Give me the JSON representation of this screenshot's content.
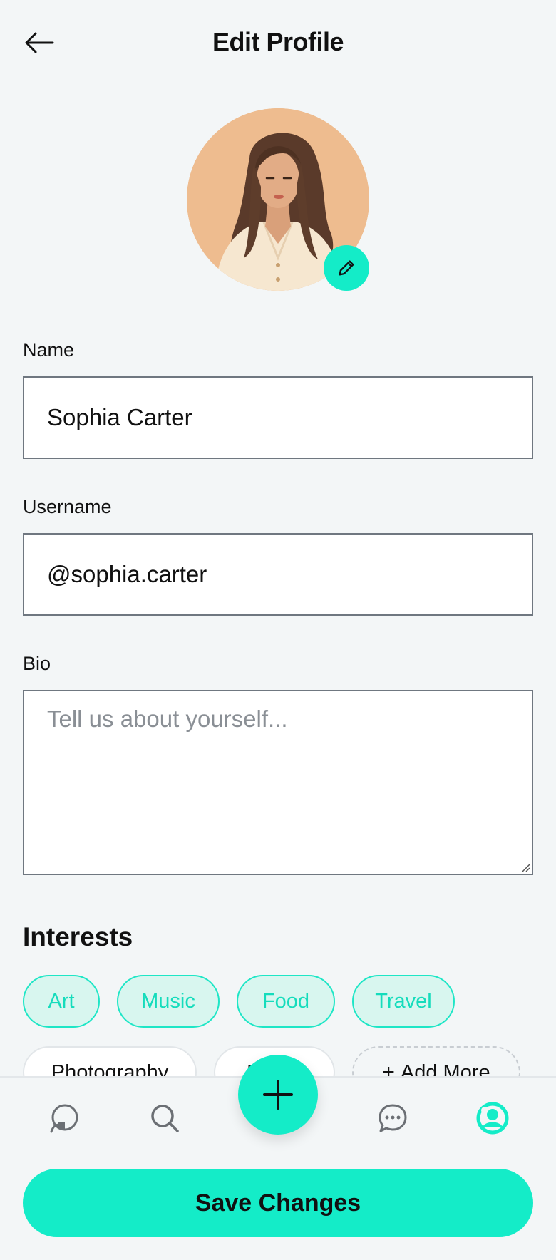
{
  "header": {
    "title": "Edit Profile"
  },
  "profile": {
    "name_label": "Name",
    "name_value": "Sophia Carter",
    "username_label": "Username",
    "username_value": "@sophia.carter",
    "bio_label": "Bio",
    "bio_placeholder": "Tell us about yourself..."
  },
  "interests": {
    "title": "Interests",
    "chips": [
      {
        "label": "Art",
        "selected": true
      },
      {
        "label": "Music",
        "selected": true
      },
      {
        "label": "Food",
        "selected": true
      },
      {
        "label": "Travel",
        "selected": true
      },
      {
        "label": "Photography",
        "selected": false
      },
      {
        "label": "F",
        "selected": false
      }
    ],
    "add_label": "Add More"
  },
  "nav": {
    "items": [
      "home-icon",
      "search-icon",
      "add-icon",
      "chat-icon",
      "profile-icon"
    ],
    "active": "profile-icon"
  },
  "actions": {
    "save_label": "Save Changes"
  },
  "colors": {
    "accent": "#14ecc8",
    "chip_selected_bg": "#d8f6ef",
    "background": "#f3f6f7"
  }
}
